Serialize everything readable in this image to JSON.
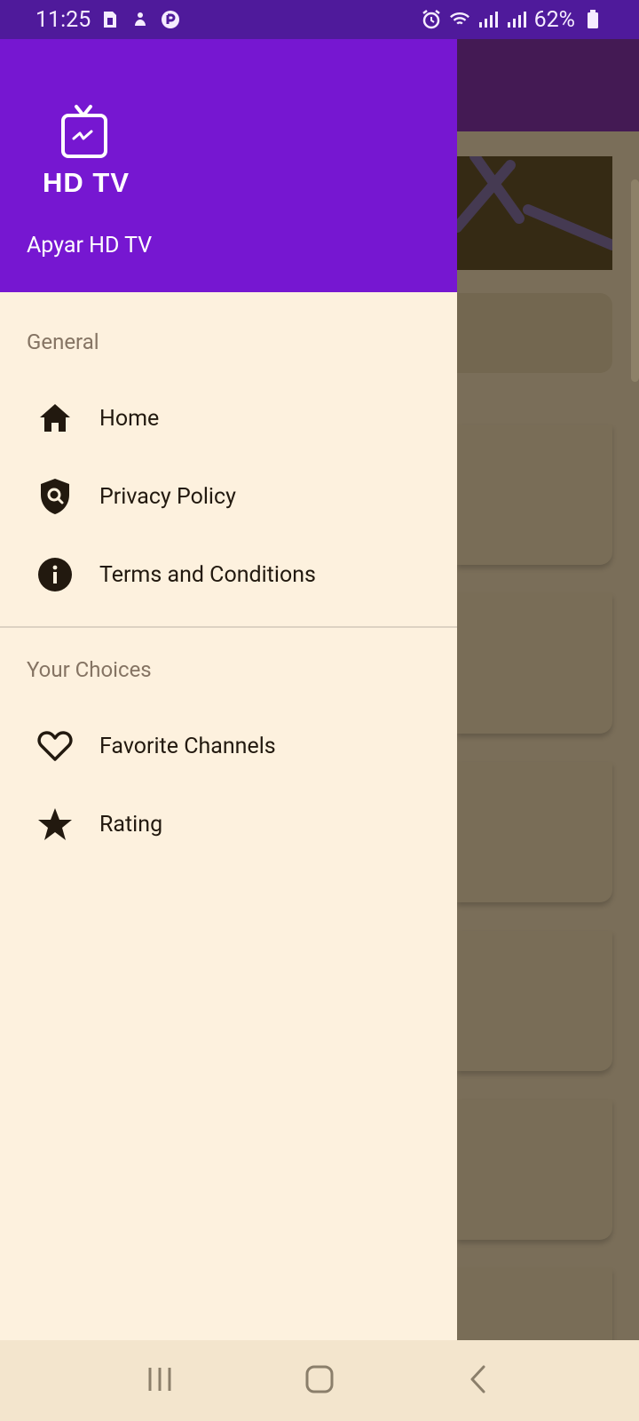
{
  "status_bar": {
    "time": "11:25",
    "battery": "62%",
    "icons": [
      "sim-icon",
      "notification-icon",
      "app-icon",
      "alarm-icon",
      "wifi-icon",
      "signal-icon",
      "signal-icon-2",
      "battery-icon"
    ]
  },
  "drawer": {
    "logo_text": "HD TV",
    "app_name": "Apyar HD TV",
    "sections": [
      {
        "title": "General",
        "items": [
          {
            "label": "Home",
            "icon": "home-icon"
          },
          {
            "label": "Privacy Policy",
            "icon": "shield-search-icon"
          },
          {
            "label": "Terms and Conditions",
            "icon": "info-icon"
          }
        ]
      },
      {
        "title": "Your Choices",
        "items": [
          {
            "label": "Favorite Channels",
            "icon": "heart-icon"
          },
          {
            "label": "Rating",
            "icon": "star-icon"
          }
        ]
      }
    ]
  },
  "nav_bar": {
    "buttons": [
      "recent-apps-icon",
      "home-nav-icon",
      "back-icon"
    ]
  },
  "colors": {
    "status_bar": "#4f1a9b",
    "drawer_header": "#7617d1",
    "drawer_bg": "#fdf1de",
    "text_primary": "#22190f",
    "section_title": "#857463",
    "scrim": "#7a6e59"
  }
}
